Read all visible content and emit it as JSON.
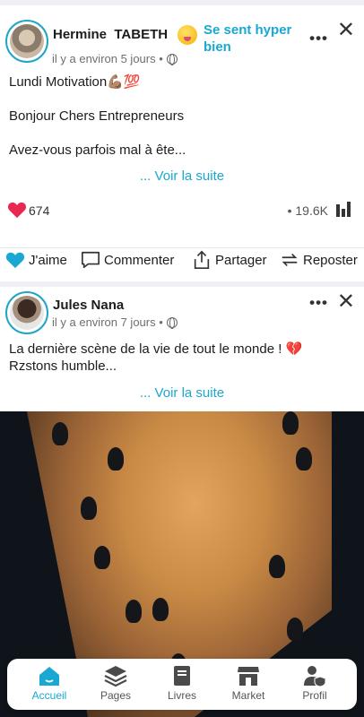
{
  "post1": {
    "author": "Hermine  TABETH",
    "feeling": "Se sent hyper bien",
    "time": "il y a environ 5 jours •",
    "lines": "Lundi Motivation💪🏽💯\n\nBonjour Chers Entrepreneurs\n\nAvez-vous parfois mal à ête...",
    "see_more": "... Voir la suite",
    "likes": "674",
    "views": "• 19.6K"
  },
  "post2": {
    "author": "Jules Nana",
    "time": "il y a environ 7 jours •",
    "lines": "La dernière scène de la vie de tout le monde ! 💔\nRzstons humble...",
    "see_more": "... Voir la suite"
  },
  "actions": {
    "like": "J'aime",
    "comment": "Commenter",
    "share": "Partager",
    "repost": "Reposter"
  },
  "nav": {
    "home": "Accueil",
    "pages": "Pages",
    "books": "Livres",
    "market": "Market",
    "profile": "Profil"
  },
  "colors": {
    "accent": "#19a8d1",
    "heart": "#e8284f"
  }
}
